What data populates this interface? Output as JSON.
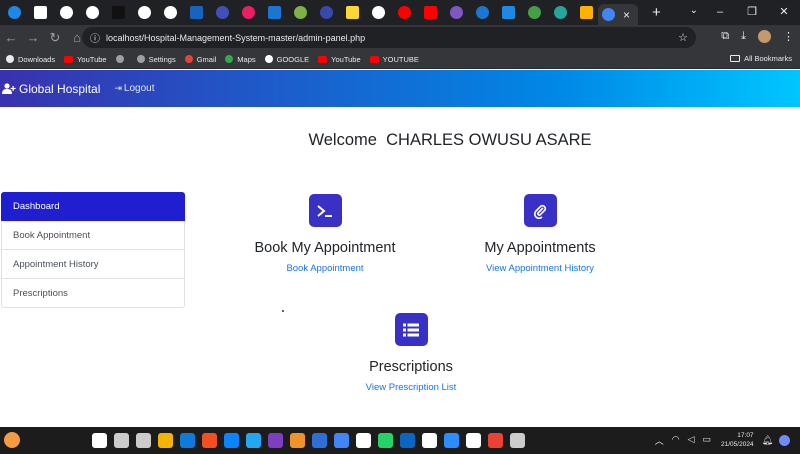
{
  "browser": {
    "active_tab_close": "×",
    "new_tab": "+",
    "window_controls": [
      "–",
      "❐",
      "✕"
    ],
    "url": "localhost/Hospital-Management-System-master/admin-panel.php",
    "tab_favicons": [
      "#1e88e5",
      "#ffffff",
      "#ffffff",
      "#ffffff",
      "#111111",
      "#ffffff",
      "#ffffff",
      "#1565c0",
      "#3f51b5",
      "#e91e63",
      "#1976d2",
      "#7cb342",
      "#3949ab",
      "#fdd835",
      "#ffffff",
      "#ff0000",
      "#ff0000",
      "#7e57c2",
      "#1976d2",
      "#1e88e5",
      "#43a047",
      "#26a69a",
      "#ffb300"
    ]
  },
  "bookmarks": {
    "items": [
      {
        "label": "Downloads",
        "icon": "download-icon",
        "color": "#e8eaed"
      },
      {
        "label": "YouTube",
        "icon": "youtube-icon",
        "color": "#ff0000"
      },
      {
        "label": "",
        "icon": "globe-icon",
        "color": "#9aa0a6"
      },
      {
        "label": "Settings",
        "icon": "gear-icon",
        "color": "#9aa0a6"
      },
      {
        "label": "Gmail",
        "icon": "gmail-icon",
        "color": "#ea4335"
      },
      {
        "label": "Maps",
        "icon": "maps-icon",
        "color": "#34a853"
      },
      {
        "label": "GOOGLE",
        "icon": "google-icon",
        "color": "#ffffff"
      },
      {
        "label": "YouTube",
        "icon": "youtube-icon",
        "color": "#ff0000"
      },
      {
        "label": "YOUTUBE",
        "icon": "youtube-icon",
        "color": "#ff0000"
      }
    ],
    "all_bookmarks": "All Bookmarks"
  },
  "navbar": {
    "brand": "Global Hospital",
    "logout": "Logout"
  },
  "welcome": {
    "prefix": "Welcome",
    "name": "CHARLES OWUSU ASARE"
  },
  "sidebar": {
    "items": [
      {
        "label": "Dashboard",
        "active": true
      },
      {
        "label": "Book Appointment",
        "active": false
      },
      {
        "label": "Appointment History",
        "active": false
      },
      {
        "label": "Prescriptions",
        "active": false
      }
    ]
  },
  "cards": [
    {
      "title": "Book My Appointment",
      "link": "Book Appointment",
      "icon": "terminal-icon"
    },
    {
      "title": "My Appointments",
      "link": "View Appointment History",
      "icon": "paperclip-icon"
    },
    {
      "title": "Prescriptions",
      "link": "View Prescription List",
      "icon": "list-icon"
    }
  ],
  "taskbar": {
    "time": "17:07",
    "date": "21/05/2024",
    "apps": [
      "#ffffff",
      "#cccccc",
      "#cccccc",
      "#f2b600",
      "#0f7bd8",
      "#f25022",
      "#0a84ff",
      "#22a7f0",
      "#7b3fbf",
      "#f0932b",
      "#2d6fd6",
      "#4285f4",
      "#ffffff",
      "#25d366",
      "#0a66c2",
      "#ffffff",
      "#2d8cff",
      "#ffffff",
      "#ea4335",
      "#cccccc"
    ]
  },
  "colors": {
    "accent": "#3931af",
    "sidebar_active": "#1f1ed1",
    "link": "#1a73e8"
  }
}
